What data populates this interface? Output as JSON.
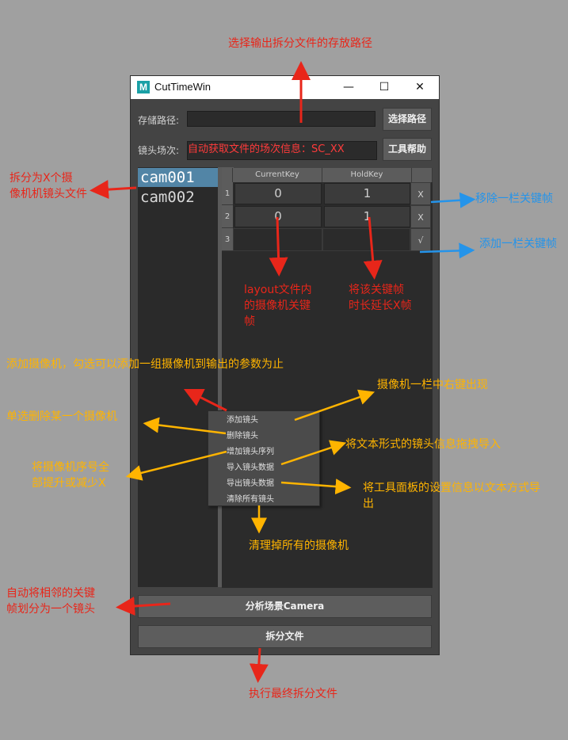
{
  "window": {
    "title": "CutTimeWin",
    "logo": "M",
    "controls": {
      "minimize": "—",
      "maximize": "☐",
      "close": "✕"
    }
  },
  "path_row": {
    "label": "存储路径:",
    "value": "",
    "button": "选择路径"
  },
  "scene_row": {
    "label": "镜头场次:",
    "value": "自动获取文件的场次信息：SC_XX",
    "button": "工具帮助"
  },
  "cameras": [
    "cam001",
    "cam002"
  ],
  "table": {
    "headers": [
      "CurrentKey",
      "HoldKey"
    ],
    "rows": [
      {
        "index": "1",
        "current": "0",
        "hold": "1",
        "action": "X"
      },
      {
        "index": "2",
        "current": "0",
        "hold": "1",
        "action": "X"
      },
      {
        "index": "3",
        "current": "",
        "hold": "",
        "action": "√"
      }
    ]
  },
  "context_menu": [
    "添加镜头",
    "删除镜头",
    "增加镜头序列",
    "导入镜头数据",
    "导出镜头数据",
    "清除所有镜头"
  ],
  "buttons": {
    "analyze": "分析场景Camera",
    "split": "拆分文件"
  },
  "annotations": {
    "output_path": "选择输出拆分文件的存放路径",
    "split_cam": [
      "拆分为X个摄",
      "像机机镜头文件"
    ],
    "remove_key": "移除一栏关键帧",
    "add_key": "添加一栏关键帧",
    "layout_key": [
      "layout文件内",
      "的摄像机关键",
      "帧"
    ],
    "hold_key": [
      "将该关键帧",
      "时长延长X帧"
    ],
    "add_cam": "添加摄像机，勾选可以添加一组摄像机到输出的参数为止",
    "right_click": "摄像机一栏中右键出现",
    "delete_cam": "单选删除某一个摄像机",
    "import": "将文本形式的镜头信息拖拽导入",
    "shift": [
      "将摄像机序号全",
      "部提升或减少X"
    ],
    "export": [
      "将工具面板的设置信息以文本方式导",
      "出"
    ],
    "clear": "清理掉所有的摄像机",
    "auto": [
      "自动将相邻的关键",
      "帧划分为一个镜头"
    ],
    "execute": "执行最终拆分文件"
  },
  "colors": {
    "annotation_red": "#e8261a",
    "annotation_blue": "#2594ea",
    "annotation_yellow": "#ffb400",
    "selection": "#5285a6"
  }
}
